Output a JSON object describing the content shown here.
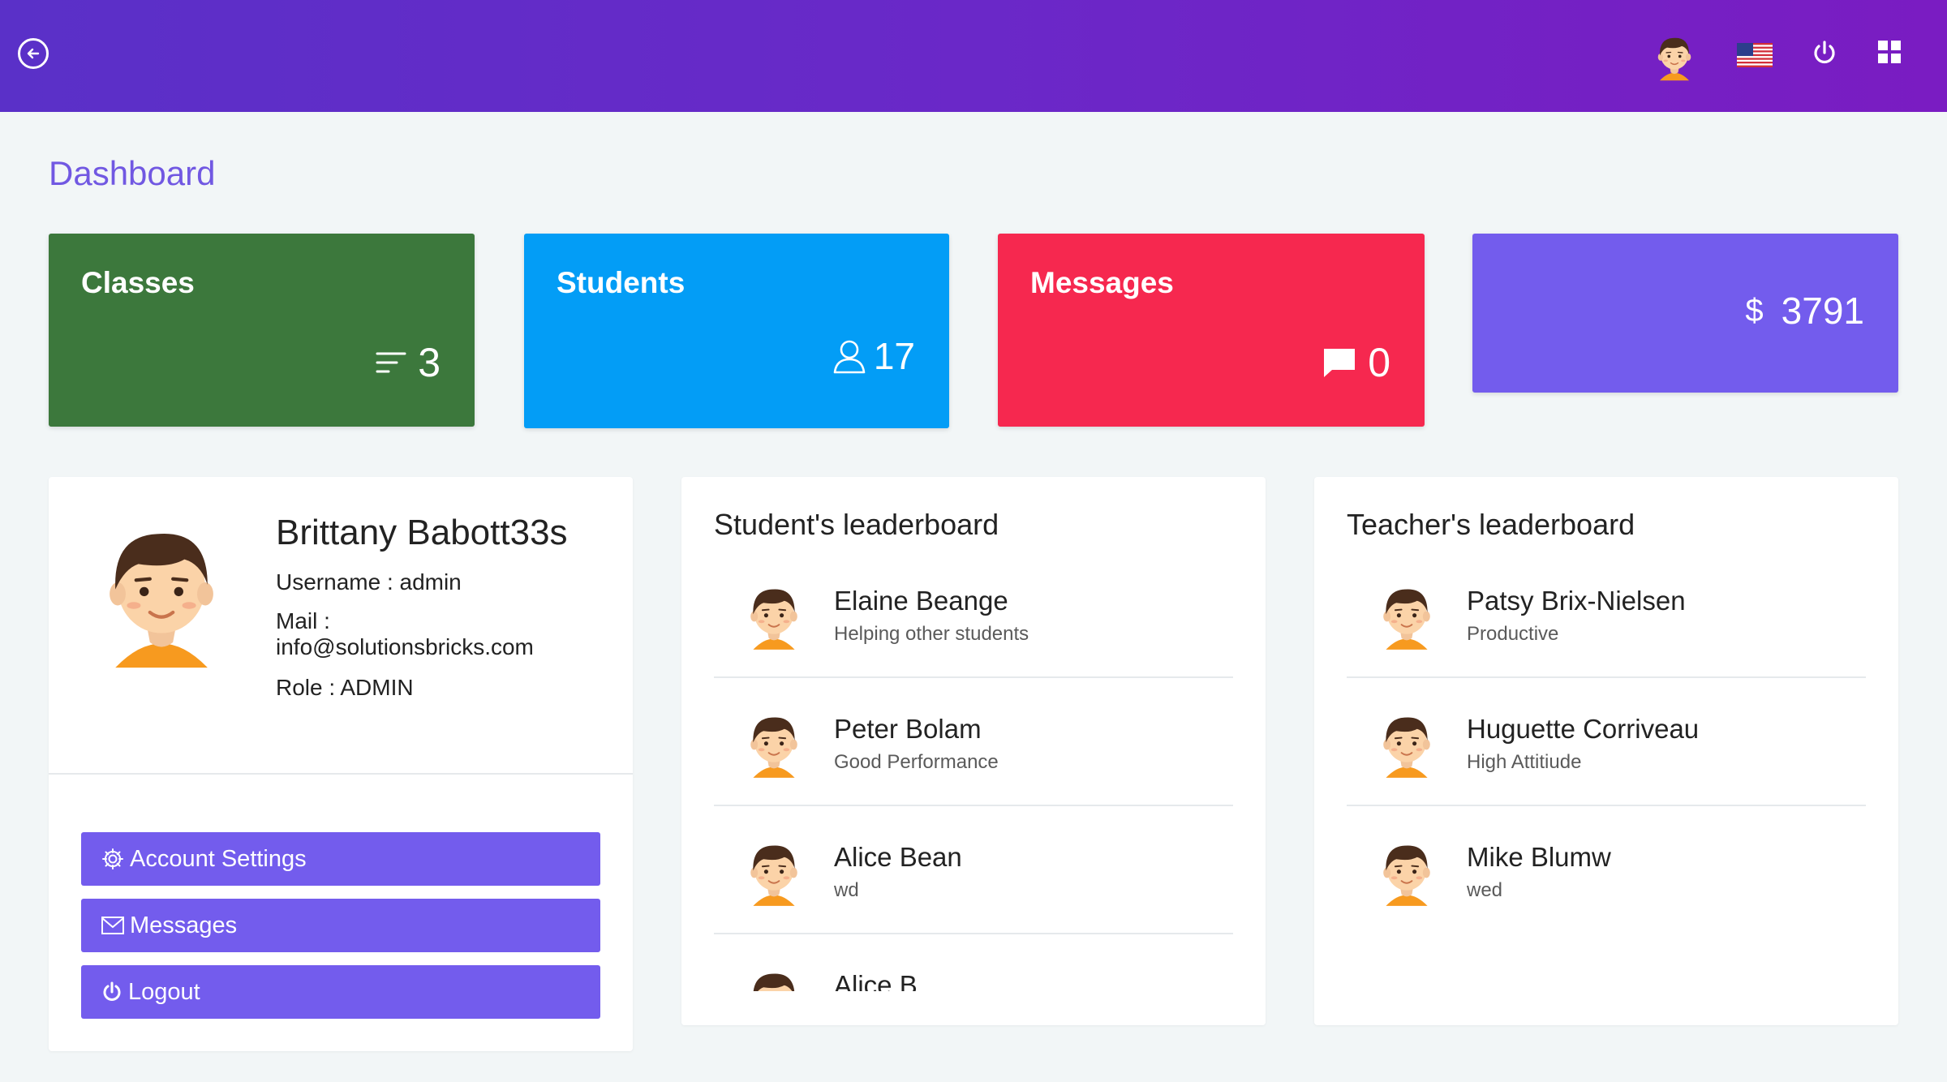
{
  "header": {
    "back_icon": "arrow-left-circle-icon",
    "avatar_icon": "user-avatar-icon",
    "flag_icon": "us-flag-icon",
    "power_icon": "power-icon",
    "grid_icon": "apps-grid-icon"
  },
  "page": {
    "title": "Dashboard"
  },
  "stats": {
    "classes": {
      "label": "Classes",
      "value": "3",
      "icon": "sort-lines-icon",
      "color": "#3c783c"
    },
    "students": {
      "label": "Students",
      "value": "17",
      "icon": "user-icon",
      "color": "#039df6"
    },
    "messages": {
      "label": "Messages",
      "value": "0",
      "icon": "chat-bubble-icon",
      "color": "#f6284f"
    },
    "money": {
      "currency": "$",
      "value": "3791",
      "color": "#735ced"
    }
  },
  "profile": {
    "name": "Brittany Babott33s",
    "username": "Username : admin",
    "mail_label": "Mail :",
    "mail": "info@solutionsbricks.com",
    "role": "Role : ADMIN",
    "actions": [
      {
        "label": "Account Settings",
        "icon": "gear-icon"
      },
      {
        "label": "Messages",
        "icon": "envelope-icon"
      },
      {
        "label": "Logout",
        "icon": "power-icon"
      }
    ]
  },
  "student_leaderboard": {
    "title": "Student's leaderboard",
    "items": [
      {
        "name": "Elaine Beange",
        "note": "Helping other students"
      },
      {
        "name": "Peter Bolam",
        "note": "Good Performance"
      },
      {
        "name": "Alice Bean",
        "note": "wd"
      },
      {
        "name": "Alice B",
        "note": ""
      }
    ]
  },
  "teacher_leaderboard": {
    "title": "Teacher's leaderboard",
    "items": [
      {
        "name": "Patsy Brix-Nielsen",
        "note": "Productive"
      },
      {
        "name": "Huguette Corriveau",
        "note": "High Attitiude"
      },
      {
        "name": "Mike Blumw",
        "note": "wed"
      }
    ]
  },
  "colors": {
    "accent": "#735ced",
    "header_start": "#5a30c8",
    "header_end": "#7a1cc2",
    "background": "#f2f6f7"
  }
}
